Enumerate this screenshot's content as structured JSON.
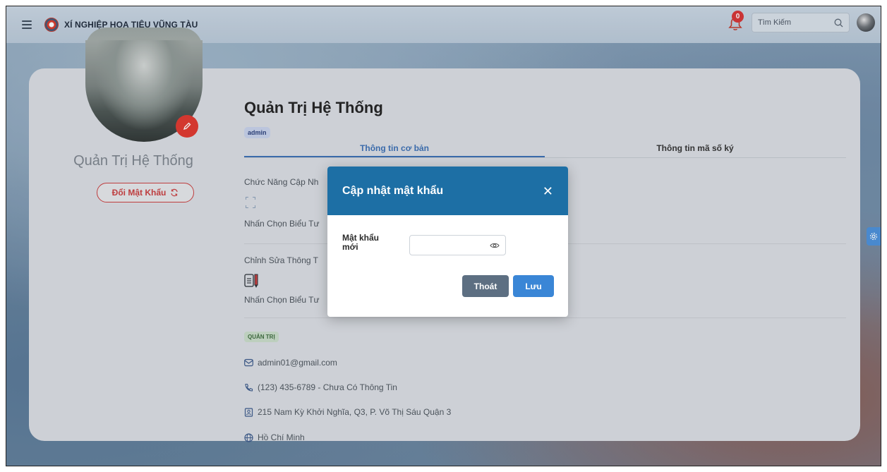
{
  "header": {
    "brand": "XÍ NGHIỆP HOA TIÊU VŨNG TÀU",
    "notification_count": "0",
    "search_placeholder": "Tìm Kiếm"
  },
  "profile": {
    "left_name": "Quản Trị Hệ Thống",
    "change_password_label": "Đổi Mật Khẩu",
    "title": "Quản Trị Hệ Thống",
    "role_badge": "admin"
  },
  "tabs": [
    {
      "label": "Thông tin cơ bản",
      "active": true
    },
    {
      "label": "Thông tin mã số ký",
      "active": false
    }
  ],
  "sections": {
    "update_function_label": "Chức Năng Cập Nh",
    "update_function_hint": "Nhấn Chọn Biểu Tư",
    "edit_info_label": "Chỉnh Sửa Thông T",
    "edit_info_hint": "Nhấn Chọn Biểu Tư"
  },
  "contact": {
    "group_badge": "QUẢN TRỊ",
    "email": "admin01@gmail.com",
    "phone": "(123) 435-6789 - Chưa Có Thông Tin",
    "address": "215 Nam Kỳ Khởi Nghĩa, Q3, P. Võ Thị Sáu Quận 3",
    "city": "Hồ Chí Minh"
  },
  "modal": {
    "title": "Cập nhật mật khẩu",
    "close_symbol": "✕",
    "field_label": "Mật khẩu mới",
    "field_value": "",
    "exit_label": "Thoát",
    "save_label": "Lưu"
  },
  "colors": {
    "modal_header": "#1d6fa5",
    "save_button": "#3a86d6",
    "exit_button": "#5d6f82",
    "danger": "#c93d3d"
  }
}
